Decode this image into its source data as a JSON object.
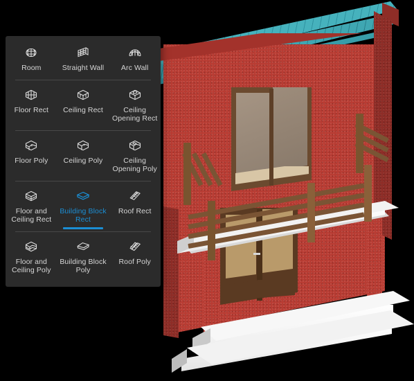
{
  "scene": {
    "name": "isometric-building-render",
    "description": "Isometric 3D architectural model of a two-story red stucco building with a teal tiled roof, an upper balcony with wooden railings, sliding glass doors above, French doors below and a white porch with a step.",
    "colors": {
      "background": "#000000",
      "wall_stucco_red": "#b83c33",
      "wall_shadow_red": "#8e2d27",
      "fascia_red": "#a3322b",
      "roof_teal": "#46b2bd",
      "roof_teal_dark": "#2f93a1",
      "railing_wood": "#7a5434",
      "railing_wood_light": "#8a6039",
      "door_wood": "#5a3a22",
      "door_glass": "#b99a6a",
      "upper_glass": "#a59483",
      "concrete_white": "#f7f7f7",
      "concrete_shadow": "#c9c9c9"
    },
    "parts": {
      "roof": "teal-tile-roof",
      "balcony": "balcony-slab",
      "railing": "wood-railing",
      "upper_door": "upper-sliding-glass-door",
      "lower_door": "french-double-door",
      "porch": "porch-slab",
      "step": "porch-step"
    }
  },
  "tool_panel": {
    "name": "modeling-tools-palette",
    "accent_color": "#1b8ed4",
    "background_color": "#2b2b2b",
    "label_color": "#d6d6d6",
    "selected_tool": "Building Block Rect",
    "groups": [
      {
        "name": "walls",
        "items": [
          {
            "label": "Room",
            "icon": "room-icon",
            "selected": false
          },
          {
            "label": "Straight Wall",
            "icon": "straight-wall-icon",
            "selected": false
          },
          {
            "label": "Arc Wall",
            "icon": "arc-wall-icon",
            "selected": false
          }
        ]
      },
      {
        "name": "rect-surfaces",
        "items": [
          {
            "label": "Floor Rect",
            "icon": "floor-rect-icon",
            "selected": false
          },
          {
            "label": "Ceiling Rect",
            "icon": "ceiling-rect-icon",
            "selected": false
          },
          {
            "label": "Ceiling Opening Rect",
            "icon": "ceiling-opening-rect-icon",
            "selected": false
          }
        ]
      },
      {
        "name": "poly-surfaces",
        "items": [
          {
            "label": "Floor Poly",
            "icon": "floor-poly-icon",
            "selected": false
          },
          {
            "label": "Ceiling Poly",
            "icon": "ceiling-poly-icon",
            "selected": false
          },
          {
            "label": "Ceiling Opening Poly",
            "icon": "ceiling-opening-poly-icon",
            "selected": false
          }
        ]
      },
      {
        "name": "blocks-rect",
        "items": [
          {
            "label": "Floor and Ceiling Rect",
            "icon": "floor-and-ceiling-rect-icon",
            "selected": false
          },
          {
            "label": "Building Block Rect",
            "icon": "building-block-rect-icon",
            "selected": true
          },
          {
            "label": "Roof Rect",
            "icon": "roof-rect-icon",
            "selected": false
          }
        ]
      },
      {
        "name": "blocks-poly",
        "items": [
          {
            "label": "Floor and Ceiling Poly",
            "icon": "floor-and-ceiling-poly-icon",
            "selected": false
          },
          {
            "label": "Building Block Poly",
            "icon": "building-block-poly-icon",
            "selected": false
          },
          {
            "label": "Roof Poly",
            "icon": "roof-poly-icon",
            "selected": false
          }
        ]
      }
    ]
  }
}
